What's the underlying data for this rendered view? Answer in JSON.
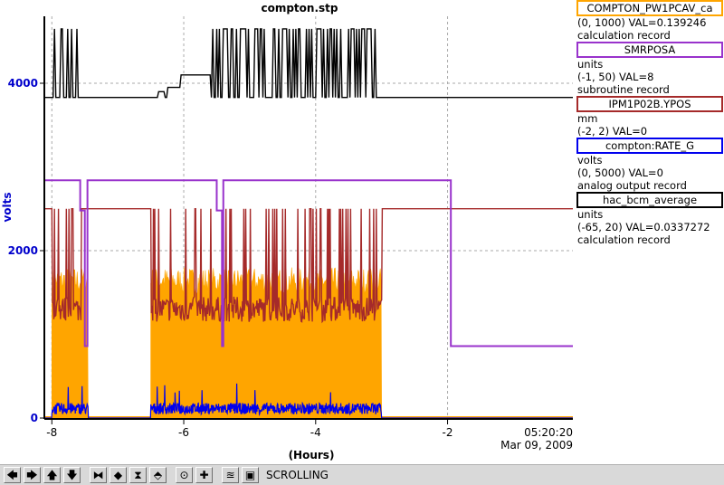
{
  "chart_data": {
    "type": "line",
    "title": "compton.stp",
    "ylabel": "volts",
    "xlabel": "(Hours)",
    "ylim": [
      0,
      4800
    ],
    "xlim": [
      -8.1,
      -0.1
    ],
    "yticks": [
      0,
      2000,
      4000
    ],
    "ytick_labels": [
      "0",
      "2000",
      "4000"
    ],
    "xticks": [
      -8,
      -6,
      -4,
      -2
    ],
    "xtick_labels": [
      "-8",
      "-6",
      "-4",
      "-2"
    ],
    "time_label": "05:20:20",
    "date_label": "Mar 09, 2009",
    "grid": true,
    "series": [
      {
        "name": "COMPTON_PW1PCAV_ca",
        "color": "#000000",
        "style": "band",
        "low": 3830,
        "high": 4650,
        "active_ranges": [
          [
            -8.0,
            -7.6
          ],
          [
            -5.6,
            -3.0
          ]
        ],
        "x": [
          -8.1,
          -8.0,
          -7.6,
          -6.5,
          -6.4,
          -6.3,
          -6.25,
          -6.1,
          -6.05,
          -5.6,
          -3.0,
          -0.1
        ],
        "values": [
          3830,
          3830,
          3830,
          3830,
          3900,
          3830,
          3950,
          3950,
          4100,
          4100,
          3830,
          3830
        ]
      },
      {
        "name": "SMRPOSA",
        "color": "#9933cc",
        "style": "step",
        "x": [
          -8.1,
          -7.57,
          -7.57,
          -7.5,
          -7.5,
          -7.46,
          -7.46,
          -5.5,
          -5.5,
          -5.42,
          -5.42,
          -5.4,
          -5.4,
          -1.95,
          -1.95,
          -0.1
        ],
        "values": [
          2840,
          2840,
          2480,
          2480,
          860,
          860,
          2840,
          2840,
          2480,
          2480,
          860,
          860,
          2840,
          2840,
          860,
          860
        ]
      },
      {
        "name": "IPM1P02B.YPOS",
        "color": "#a52a2a",
        "style": "noisy",
        "base": 2500,
        "active_level": 1300,
        "active_ranges": [
          [
            -8.0,
            -7.55
          ],
          [
            -6.5,
            -3.0
          ]
        ],
        "x": [
          -8.1,
          -0.1
        ],
        "values": [
          2500,
          2500
        ]
      },
      {
        "name": "compton:RATE_G",
        "color": "#ffa500",
        "style": "band",
        "low": 0,
        "high": 1800,
        "active_ranges": [
          [
            -8.0,
            -7.45
          ],
          [
            -6.5,
            -3.0
          ]
        ],
        "x": [
          -8.1,
          -0.1
        ],
        "values": [
          0,
          0
        ]
      },
      {
        "name": "hac_bcm_average",
        "color": "#0000ee",
        "style": "noisy-low",
        "active_level": 150,
        "active_ranges": [
          [
            -8.0,
            -7.45
          ],
          [
            -6.5,
            -3.0
          ]
        ],
        "x": [
          -8.1,
          -0.1
        ],
        "values": [
          0,
          0
        ]
      }
    ]
  },
  "legend": [
    {
      "name": "COMPTON_PW1PCAV_ca",
      "color": "#ffa500",
      "lines": [
        "(0, 1000) VAL=0.139246",
        "calculation record"
      ]
    },
    {
      "name": "SMRPOSA",
      "color": "#9933cc",
      "lines": [
        "units",
        "(-1, 50) VAL=8",
        "subroutine record"
      ]
    },
    {
      "name": "IPM1P02B.YPOS",
      "color": "#a52a2a",
      "lines": [
        "mm",
        "(-2, 2) VAL=0"
      ]
    },
    {
      "name": "compton:RATE_G",
      "color": "#0000ee",
      "lines": [
        "volts",
        "(0, 5000) VAL=0",
        "analog output record"
      ]
    },
    {
      "name": "hac_bcm_average",
      "color": "#000000",
      "lines": [
        "units",
        "(-65, 20) VAL=0.0337272",
        "calculation record"
      ]
    }
  ],
  "toolbar": {
    "status": "SCROLLING",
    "buttons": [
      {
        "name": "pan-left",
        "glyph": "🡄"
      },
      {
        "name": "pan-right",
        "glyph": "🡆"
      },
      {
        "name": "pan-up",
        "glyph": "🡅"
      },
      {
        "name": "pan-down",
        "glyph": "🡇"
      },
      {
        "name": "zoom-x-in",
        "glyph": "⧓"
      },
      {
        "name": "zoom-x-out",
        "glyph": "◆"
      },
      {
        "name": "zoom-y-in",
        "glyph": "⧗"
      },
      {
        "name": "zoom-y-out",
        "glyph": "⬘"
      },
      {
        "name": "record",
        "glyph": "⊙"
      },
      {
        "name": "add",
        "glyph": "✚"
      },
      {
        "name": "scroll-mode",
        "glyph": "≊"
      },
      {
        "name": "restore",
        "glyph": "▣"
      }
    ]
  }
}
